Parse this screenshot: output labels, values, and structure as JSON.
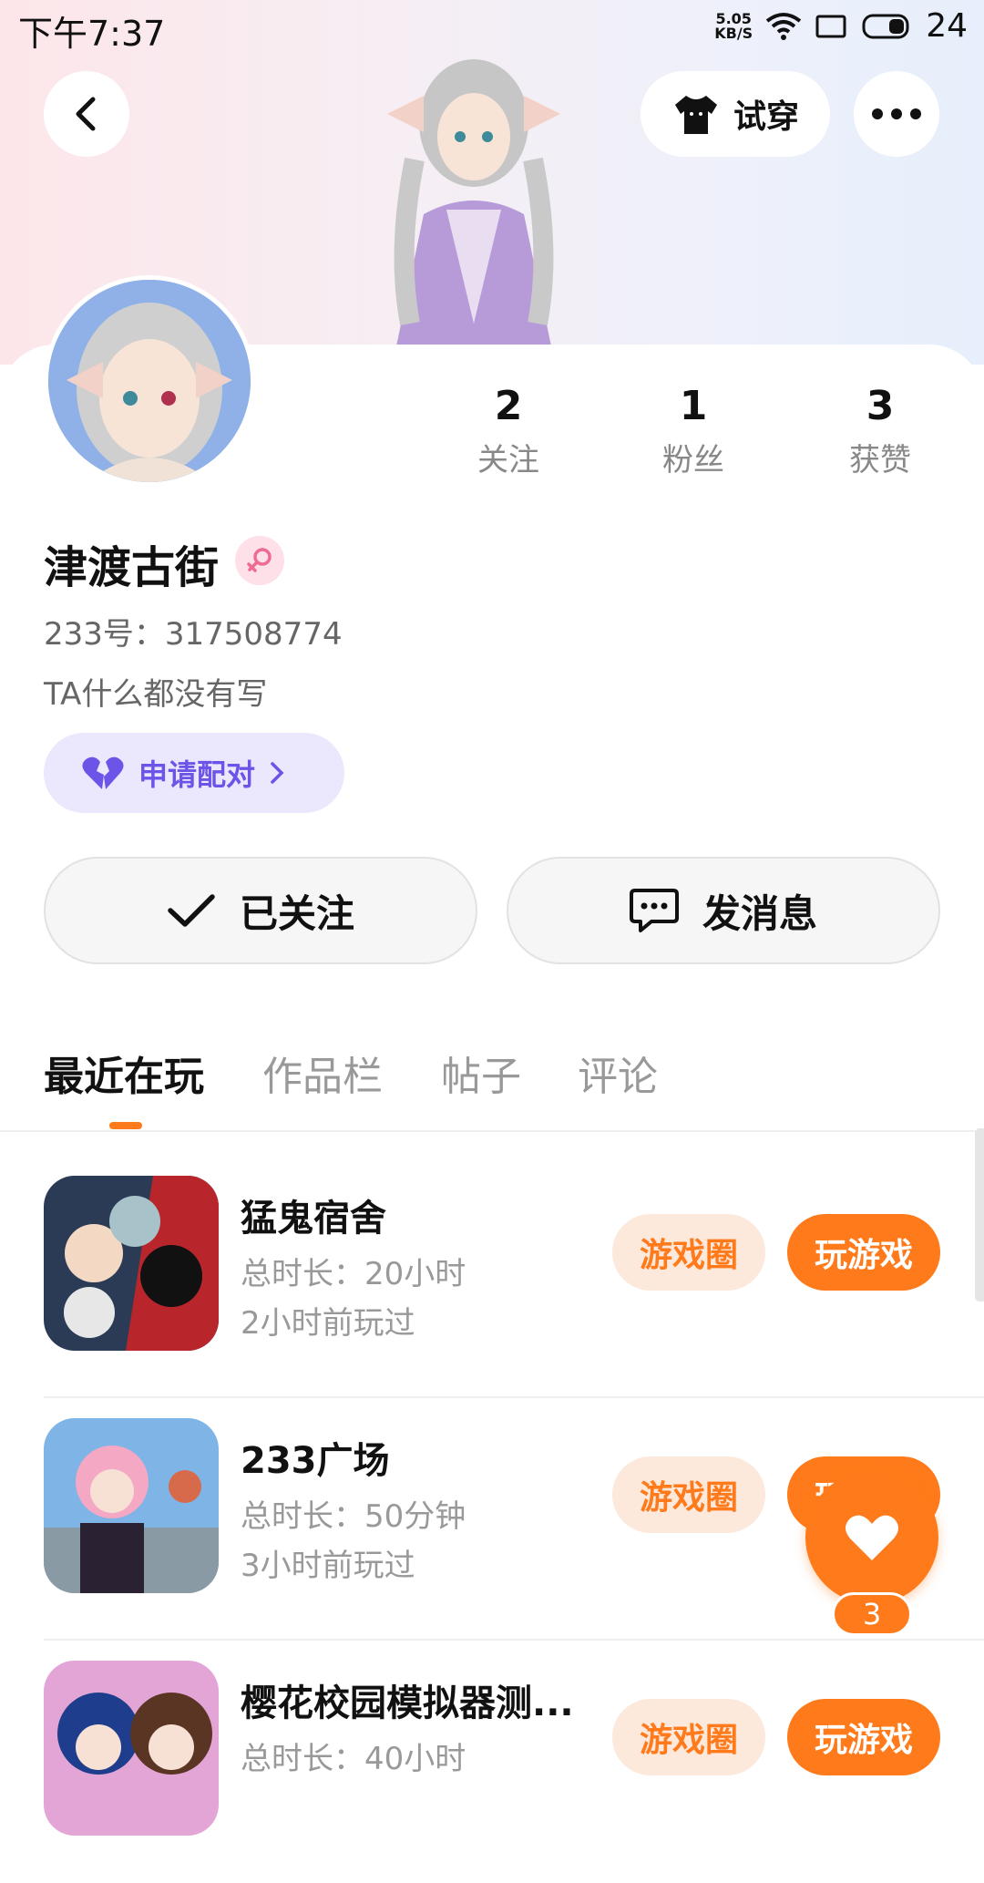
{
  "status_bar": {
    "time": "下午7:37",
    "net_speed_top": "5.05",
    "net_speed_bottom": "KB/S",
    "battery": "24"
  },
  "top_bar": {
    "try_on_label": "试穿"
  },
  "stats": [
    {
      "num": "2",
      "label": "关注"
    },
    {
      "num": "1",
      "label": "粉丝"
    },
    {
      "num": "3",
      "label": "获赞"
    }
  ],
  "profile": {
    "username": "津渡古街",
    "uid": "233号：317508774",
    "bio": "TA什么都没有写",
    "pair_label": "申请配对"
  },
  "actions": {
    "follow_label": "已关注",
    "message_label": "发消息"
  },
  "tabs": [
    "最近在玩",
    "作品栏",
    "帖子",
    "评论"
  ],
  "games": [
    {
      "title": "猛鬼宿舍",
      "duration": "总时长：20小时",
      "last_played": "2小时前玩过",
      "circle_label": "游戏圈",
      "play_label": "玩游戏"
    },
    {
      "title": "233广场",
      "duration": "总时长：50分钟",
      "last_played": "3小时前玩过",
      "circle_label": "游戏圈",
      "play_label": "玩游戏"
    },
    {
      "title": "樱花校园模拟器测...",
      "duration": "总时长：40小时",
      "last_played": "",
      "circle_label": "游戏圈",
      "play_label": "玩游戏"
    }
  ],
  "like_fab": {
    "count": "3"
  },
  "colors": {
    "accent": "#ff7a1a",
    "pair_purple": "#6d54e8",
    "pair_bg": "#ebe8fd"
  }
}
